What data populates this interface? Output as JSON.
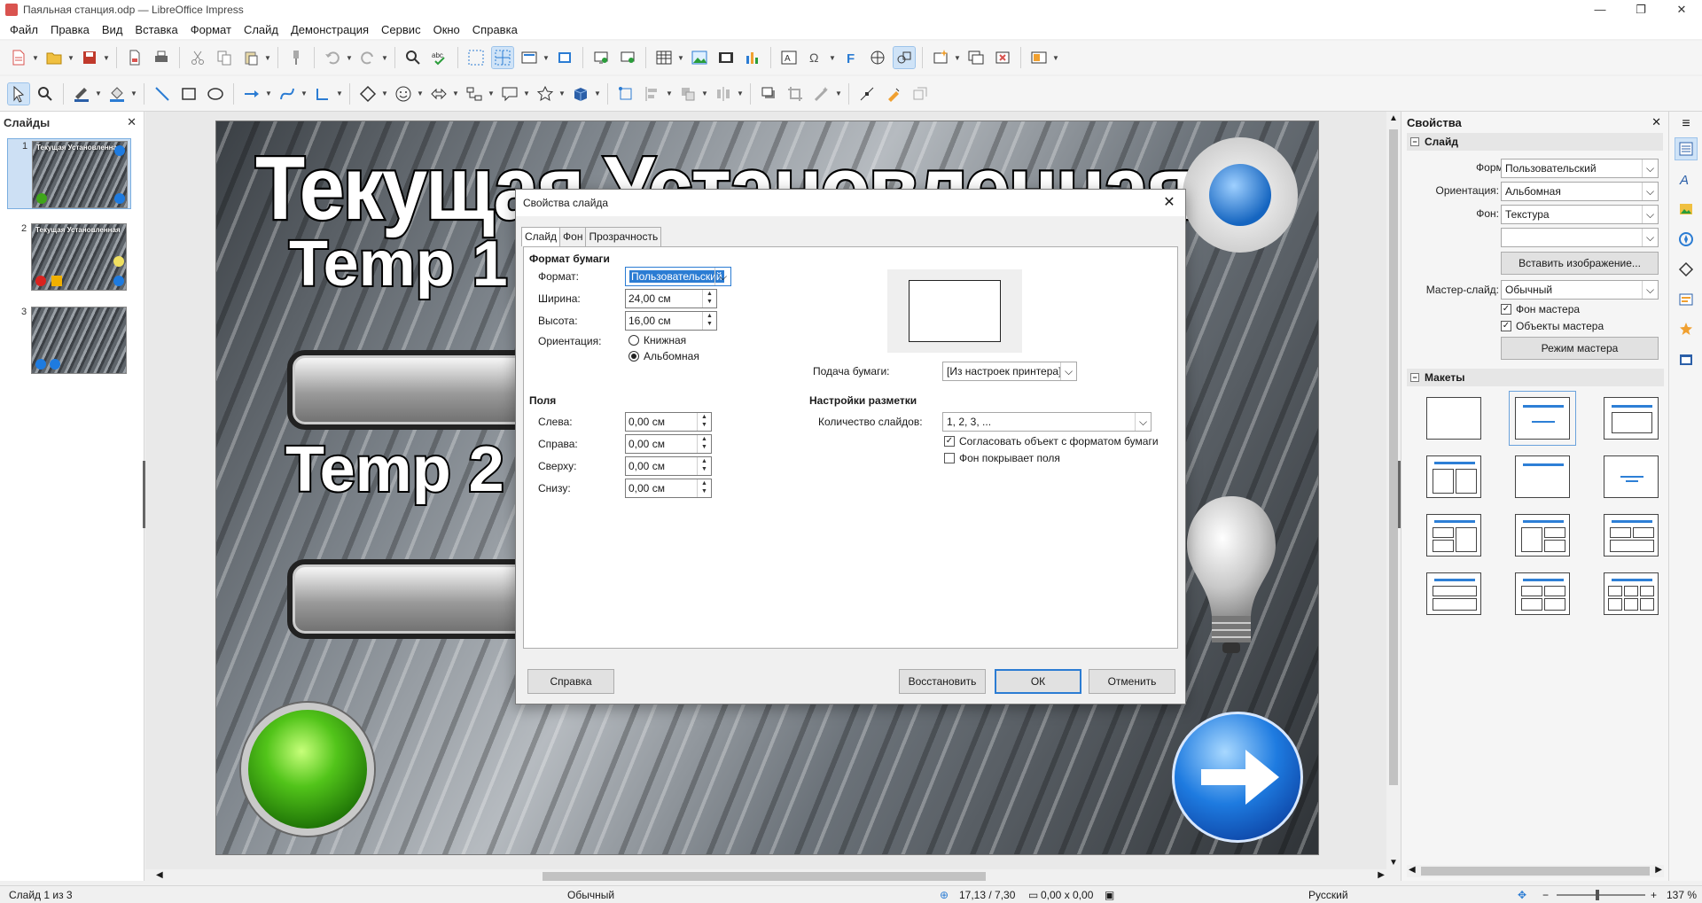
{
  "window": {
    "title": "Паяльная станция.odp — LibreOffice Impress",
    "controls": [
      "—",
      "❐",
      "✕"
    ]
  },
  "menu": [
    "Файл",
    "Правка",
    "Вид",
    "Вставка",
    "Формат",
    "Слайд",
    "Демонстрация",
    "Сервис",
    "Окно",
    "Справка"
  ],
  "slides_panel": {
    "title": "Слайды",
    "close": "✕",
    "slides": [
      {
        "num": "1",
        "thumb_text": "Текущая Установленная"
      },
      {
        "num": "2",
        "thumb_text": "Текущая Установленная"
      },
      {
        "num": "3",
        "thumb_text": ""
      }
    ]
  },
  "slide": {
    "heading": "Текущая   Установленная",
    "temp1": "Temp 1",
    "temp2": "Temp 2"
  },
  "sidebar": {
    "title": "Свойства",
    "close": "✕",
    "menu": "≡",
    "section_slide": "Слайд",
    "format_label": "Формат:",
    "format_value": "Пользовательский",
    "orientation_label": "Ориентация:",
    "orientation_value": "Альбомная",
    "background_label": "Фон:",
    "background_value": "Текстура",
    "background_sub_value": "",
    "insert_image_button": "Вставить изображение...",
    "master_slide_label": "Мастер-слайд:",
    "master_slide_value": "Обычный",
    "master_background": "Фон мастера",
    "master_objects": "Объекты мастера",
    "master_mode_button": "Режим мастера",
    "section_layouts": "Макеты"
  },
  "dialog": {
    "title": "Свойства слайда",
    "tabs": [
      "Слайд",
      "Фон",
      "Прозрачность"
    ],
    "paper_format_group": "Формат бумаги",
    "format_label": "Формат:",
    "format_value": "Пользовательский",
    "width_label": "Ширина:",
    "width_value": "24,00 см",
    "height_label": "Высота:",
    "height_value": "16,00 см",
    "orientation_label": "Ориентация:",
    "portrait": "Книжная",
    "landscape": "Альбомная",
    "paper_tray_label": "Подача бумаги:",
    "paper_tray_value": "[Из настроек принтера]",
    "margins_group": "Поля",
    "left_label": "Слева:",
    "left_value": "0,00 см",
    "right_label": "Справа:",
    "right_value": "0,00 см",
    "top_label": "Сверху:",
    "top_value": "0,00 см",
    "bottom_label": "Снизу:",
    "bottom_value": "0,00 см",
    "layout_settings_group": "Настройки разметки",
    "slide_numbers_label": "Количество слайдов:",
    "slide_numbers_value": "1, 2, 3, ...",
    "fit_object": "Согласовать объект с форматом бумаги",
    "bg_covers_margins": "Фон покрывает поля",
    "help_button": "Справка",
    "reset_button": "Восстановить",
    "ok_button": "ОК",
    "cancel_button": "Отменить"
  },
  "statusbar": {
    "slide_info": "Слайд 1 из 3",
    "master": "Обычный",
    "position": "17,13 / 7,30",
    "size": "0,00 x 0,00",
    "language": "Русский",
    "zoom": "137 %"
  },
  "colors": {
    "accent": "#2b7cd3",
    "selection": "#cde0f4",
    "layout_bar": "#2d7fd6"
  }
}
